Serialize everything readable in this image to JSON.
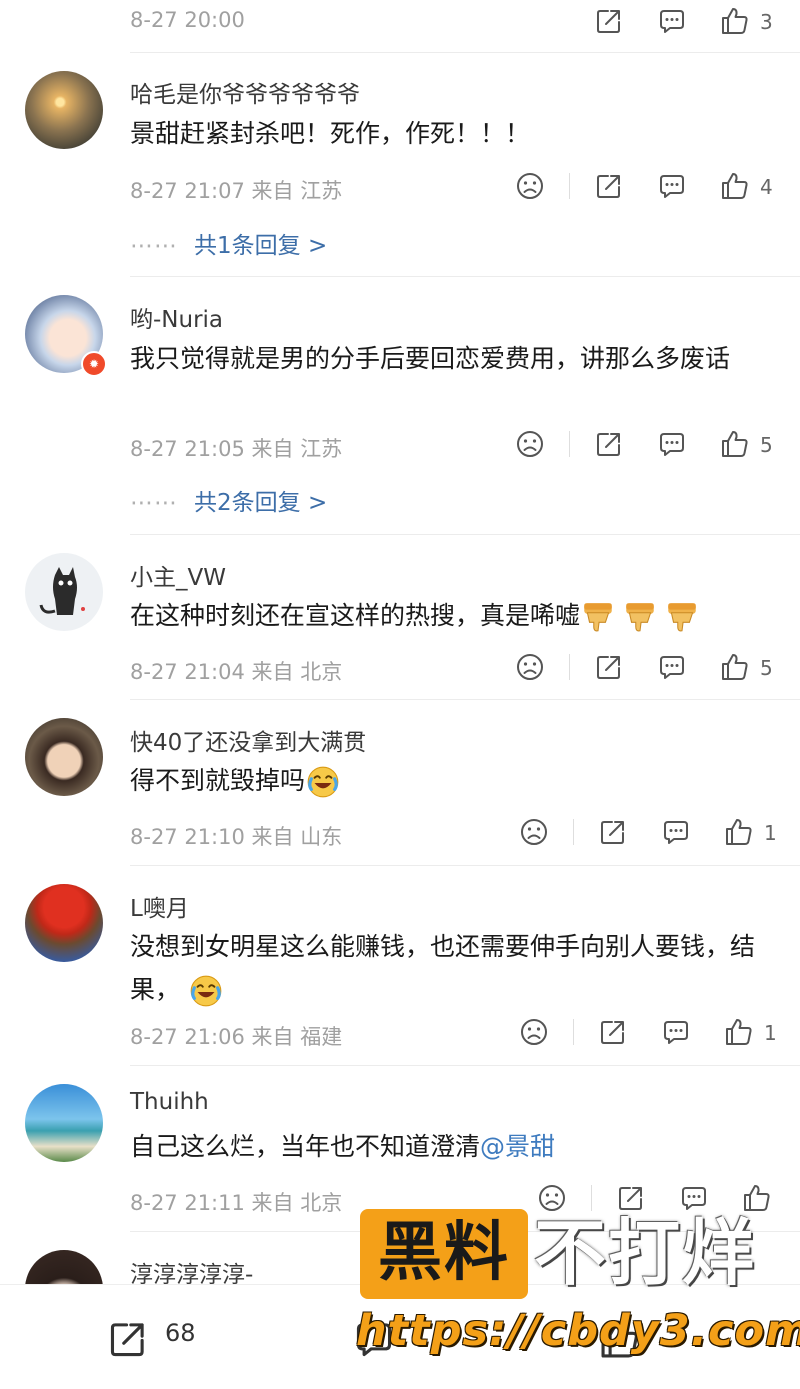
{
  "top_row": {
    "time": "8-27 20:00",
    "likes": "3"
  },
  "comments": [
    {
      "username": "哈毛是你爷爷爷爷爷爷",
      "text": "景甜赶紧封杀吧！死作，作死！！！",
      "time": "8-27 21:07 来自 江苏",
      "likes": "4",
      "reply": "共1条回复 >"
    },
    {
      "username": "哟-Nuria",
      "text": "我只觉得就是男的分手后要回恋爱费用，讲那么多废话",
      "time": "8-27 21:05 来自 江苏",
      "likes": "5",
      "reply": "共2条回复 >"
    },
    {
      "username": "小主_VW",
      "text": "在这种时刻还在宣这样的热搜，真是唏嘘",
      "time": "8-27 21:04 来自 北京",
      "likes": "5"
    },
    {
      "username": "快40了还没拿到大满贯",
      "text": "得不到就毁掉吗",
      "time": "8-27 21:10 来自 山东",
      "likes": "1"
    },
    {
      "username": "L噢月",
      "text": "没想到女明星这么能赚钱，也还需要伸手向别人要钱，结果，",
      "time": "8-27 21:06 来自 福建",
      "likes": "1"
    },
    {
      "username": "Thuihh",
      "text": "自己这么烂，当年也不知道澄清",
      "mention": "@景甜",
      "time": "8-27 21:11 来自 北京",
      "likes": ""
    },
    {
      "username": "淳淳淳淳淳-"
    }
  ],
  "reply_dots": "⋯⋯",
  "bottom_bar": {
    "share_count": "68"
  },
  "watermark": {
    "part1": "黑料",
    "part2": "不打烊",
    "url": "https://cbdy3.com"
  },
  "colors": {
    "link": "#3d6ea8",
    "accent": "#f4a018",
    "meta": "#a0a0a0"
  }
}
